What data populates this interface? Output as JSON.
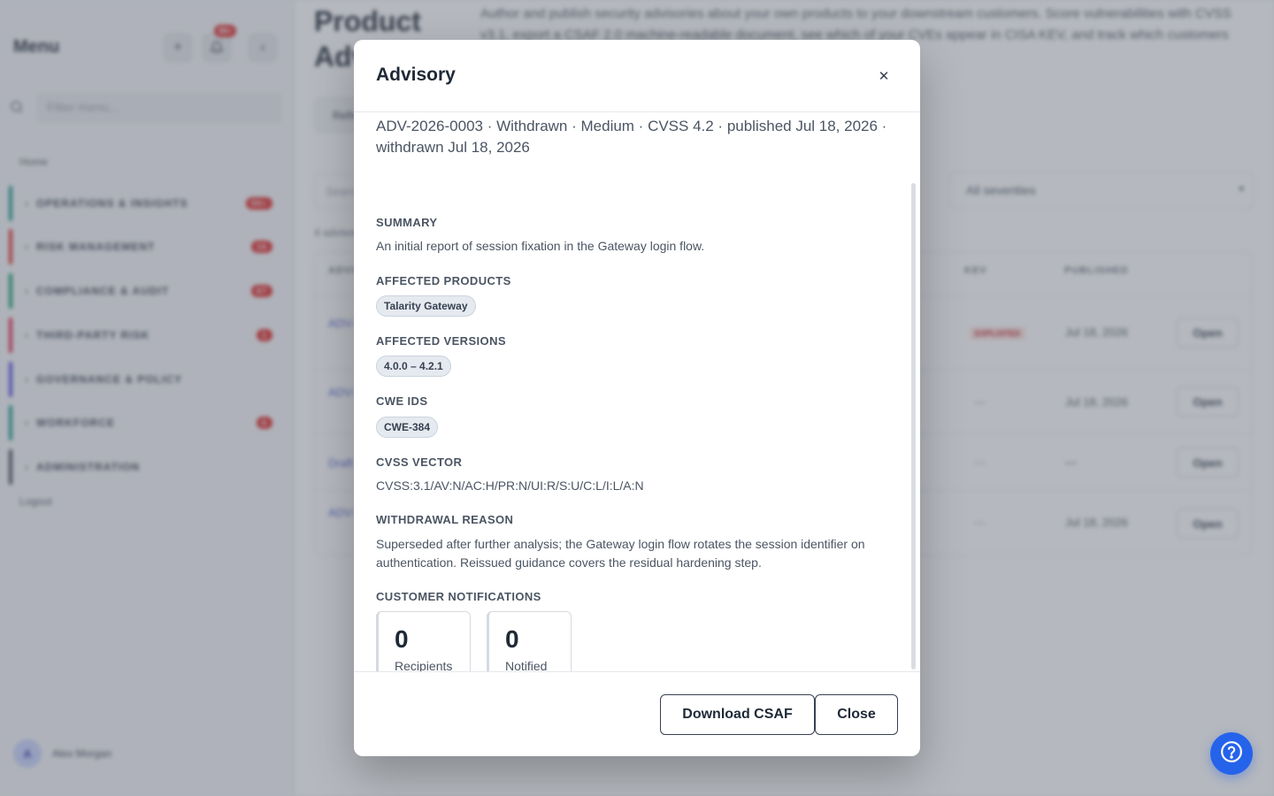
{
  "sidebar": {
    "title": "Menu",
    "add_icon": "plus-icon",
    "notification_icon": "bell-icon",
    "notification_count": "99+",
    "collapse_icon": "chevron-left-icon",
    "filter_placeholder": "Filter menu...",
    "home": "Home",
    "items": [
      {
        "label": "OPERATIONS & INSIGHTS",
        "count": "99+",
        "color": "#0d9488"
      },
      {
        "label": "RISK MANAGEMENT",
        "count": "16",
        "color": "#dc2626"
      },
      {
        "label": "COMPLIANCE & AUDIT",
        "count": "67",
        "color": "#059669"
      },
      {
        "label": "THIRD-PARTY RISK",
        "count": "1",
        "color": "#e11d48"
      },
      {
        "label": "GOVERNANCE & POLICY",
        "count": "",
        "color": "#4f46e5"
      },
      {
        "label": "WORKFORCE",
        "count": "6",
        "color": "#0d9488"
      },
      {
        "label": "ADMINISTRATION",
        "count": "",
        "color": "#374151"
      }
    ],
    "logout": "Logout",
    "user_initial": "A",
    "user_name": "Alex Morgan"
  },
  "background": {
    "page_title": "Product Advisories",
    "description": "Author and publish security advisories about your own products to your downstream customers. Score vulnerabilities with CVSS v3.1, export a CSAF 2.0 machine-readable document, see which of your CVEs appear in CISA KEV, and track which customers have been notified customers.",
    "tab": "Refresh",
    "search_placeholder": "Search",
    "severity_filter": "All severities",
    "count_text": "4 advisories",
    "columns": [
      "ADVISORY",
      "KEV",
      "PUBLISHED"
    ],
    "rows": [
      {
        "id": "ADV-2026-0001",
        "kev": "EXPLOITED",
        "published": "Jul 18, 2026",
        "action": "Open"
      },
      {
        "id": "ADV-2026-0002",
        "kev": "—",
        "published": "Jul 18, 2026",
        "action": "Open"
      },
      {
        "id": "Draft",
        "kev": "—",
        "published": "—",
        "action": "Open"
      },
      {
        "id": "ADV-2026-0003",
        "kev": "—",
        "published": "Jul 18, 2026",
        "action": "Open"
      }
    ]
  },
  "modal": {
    "title": "Advisory",
    "close_icon": "close-icon",
    "meta": "ADV-2026-0003 · Withdrawn · Medium · CVSS 4.2 · published Jul 18, 2026 · withdrawn Jul 18, 2026",
    "summary_label": "SUMMARY",
    "summary_text": "An initial report of session fixation in the Gateway login flow.",
    "products_label": "AFFECTED PRODUCTS",
    "products": [
      "Talarity Gateway"
    ],
    "versions_label": "AFFECTED VERSIONS",
    "versions": [
      "4.0.0 – 4.2.1"
    ],
    "cwe_label": "CWE IDS",
    "cwe_ids": [
      "CWE-384"
    ],
    "cvss_label": "CVSS VECTOR",
    "cvss_vector": "CVSS:3.1/AV:N/AC:H/PR:N/UI:R/S:U/C:L/I:L/A:N",
    "withdrawal_label": "WITHDRAWAL REASON",
    "withdrawal_text": "Superseded after further analysis; the Gateway login flow rotates the session identifier on authentication. Reissued guidance covers the residual hardening step.",
    "notifications_label": "CUSTOMER NOTIFICATIONS",
    "stats": [
      {
        "value": "0",
        "label": "Recipients"
      },
      {
        "value": "0",
        "label": "Notified"
      }
    ],
    "download_label": "Download CSAF",
    "close_label": "Close"
  },
  "help_icon": "help-circle-icon",
  "colors": {
    "accent": "#2563eb",
    "danger": "#dc2626"
  }
}
